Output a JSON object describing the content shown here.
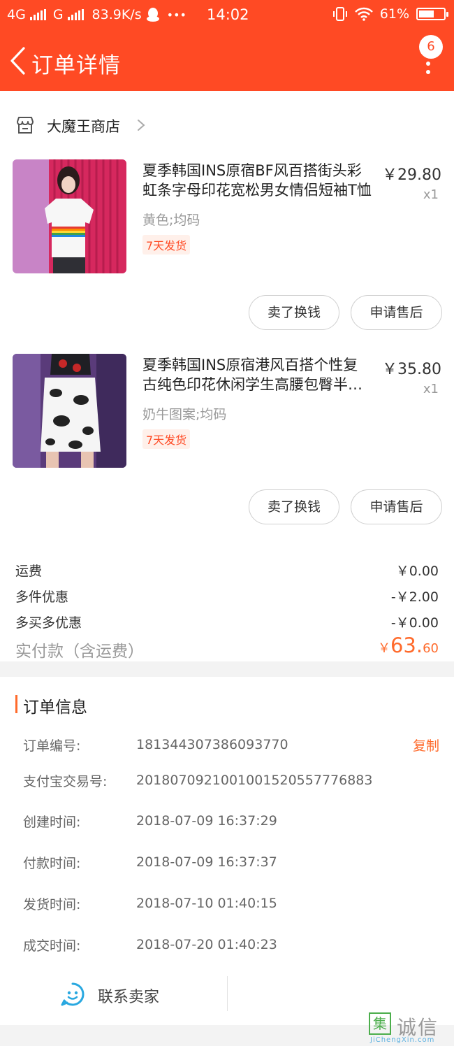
{
  "status_bar": {
    "network_1": "4G",
    "network_2": "G",
    "speed": "83.9K/s",
    "more": "•••",
    "time": "14:02",
    "battery": "61%",
    "battery_level": 0.61
  },
  "header": {
    "title": "订单详情",
    "badge_count": "6"
  },
  "shop": {
    "name": "大魔王商店"
  },
  "items": [
    {
      "title": "夏季韩国INS原宿BF风百搭街头彩虹条字母印花宽松男女情侣短袖T恤",
      "price": "￥29.80",
      "qty": "x1",
      "sku": "黄色;均码",
      "tag": "7天发货",
      "sell_label": "卖了换钱",
      "after_sale_label": "申请售后"
    },
    {
      "title": "夏季韩国INS原宿港风百搭个性复古纯色印花休闲学生高腰包臀半身裙",
      "price": "￥35.80",
      "qty": "x1",
      "sku": "奶牛图案;均码",
      "tag": "7天发货",
      "sell_label": "卖了换钱",
      "after_sale_label": "申请售后"
    }
  ],
  "summary": {
    "rows": [
      {
        "label": "运费",
        "value": "￥0.00"
      },
      {
        "label": "多件优惠",
        "value": "-￥2.00"
      },
      {
        "label": "多买多优惠",
        "value": "-￥0.00"
      }
    ],
    "total_label": "实付款（含运费）",
    "total_currency": "￥",
    "total_int": "63.",
    "total_dec": "60"
  },
  "order_info": {
    "heading": "订单信息",
    "copy_label": "复制",
    "rows": [
      {
        "label": "订单编号:",
        "value": "181344307386093770"
      },
      {
        "label": "支付宝交易号:",
        "value": "2018070921001001520557776883"
      },
      {
        "label": "创建时间:",
        "value": "2018-07-09 16:37:29"
      },
      {
        "label": "付款时间:",
        "value": "2018-07-09 16:37:37"
      },
      {
        "label": "发货时间:",
        "value": "2018-07-10 01:40:15"
      },
      {
        "label": "成交时间:",
        "value": "2018-07-20 01:40:23"
      }
    ]
  },
  "contact": {
    "label": "联系卖家"
  },
  "watermark": {
    "char": "集",
    "text": "诚信",
    "url": "JiChengXin.com"
  },
  "colors": {
    "brand": "#ff4a24",
    "accent": "#ff6a2b",
    "chat_icon": "#29a8e0"
  },
  "icons": {
    "back": "chevron-left-icon",
    "more": "more-vertical-icon",
    "shop": "store-icon",
    "chat": "chat-face-icon"
  }
}
